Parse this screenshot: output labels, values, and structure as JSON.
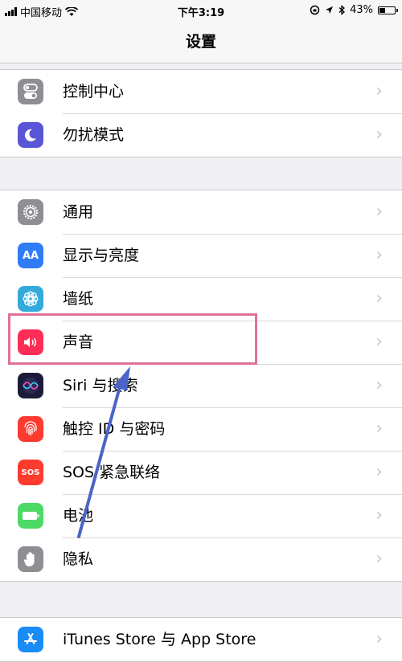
{
  "status": {
    "carrier": "中国移动",
    "time": "下午3:19",
    "battery_pct": "43%",
    "battery_level": 0.43
  },
  "nav": {
    "title": "设置"
  },
  "groups": [
    {
      "items": [
        {
          "label": "控制中心",
          "icon": "toggles-icon",
          "color": "#8e8e93"
        },
        {
          "label": "勿扰模式",
          "icon": "moon-icon",
          "color": "#5856d6"
        }
      ]
    },
    {
      "items": [
        {
          "label": "通用",
          "icon": "gear-icon",
          "color": "#8e8e93"
        },
        {
          "label": "显示与亮度",
          "icon": "display-aa-icon",
          "color": "#2f7cf6",
          "glyph": "AA"
        },
        {
          "label": "墙纸",
          "icon": "flower-icon",
          "color": "#34aadc"
        },
        {
          "label": "声音",
          "icon": "speaker-icon",
          "color": "#ff2d55"
        },
        {
          "label": "Siri 与搜索",
          "icon": "siri-icon",
          "color": "#1c1c3a"
        },
        {
          "label": "触控 ID 与密码",
          "icon": "fingerprint-icon",
          "color": "#ff3b30"
        },
        {
          "label": "SOS 紧急联络",
          "icon": "sos-icon",
          "color": "#ff3b30",
          "glyph": "SOS"
        },
        {
          "label": "电池",
          "icon": "battery-icon",
          "color": "#4cd964"
        },
        {
          "label": "隐私",
          "icon": "hand-icon",
          "color": "#8e8e93"
        }
      ]
    },
    {
      "items": [
        {
          "label": "iTunes Store 与 App Store",
          "icon": "app-store-icon",
          "color": "#1a8cf7"
        }
      ]
    }
  ],
  "chevron": "›"
}
